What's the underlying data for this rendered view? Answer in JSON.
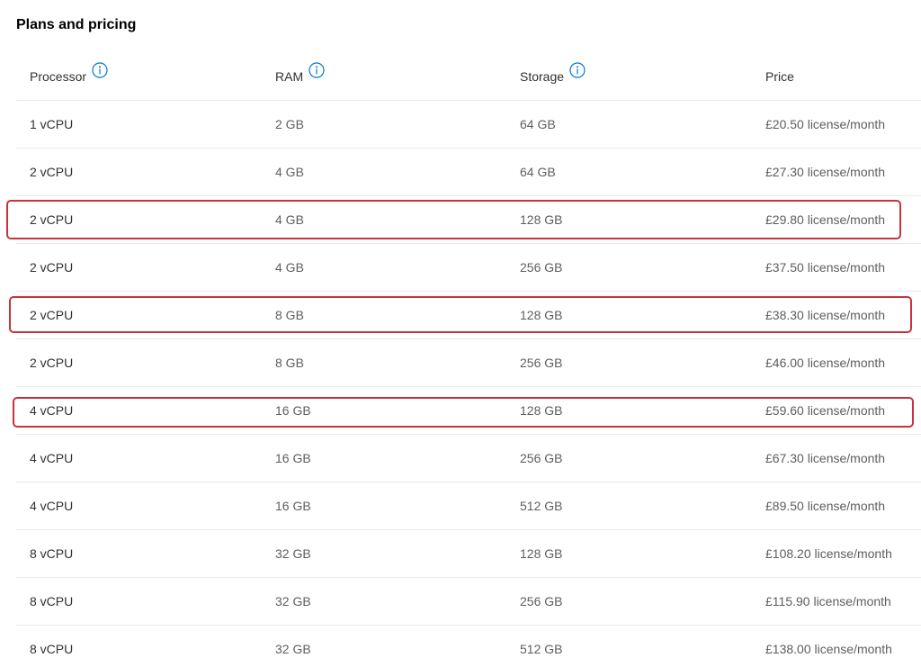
{
  "title": "Plans and pricing",
  "columns": {
    "processor": "Processor",
    "ram": "RAM",
    "storage": "Storage",
    "price": "Price"
  },
  "icons": {
    "info": "info-circle-icon"
  },
  "accent_color": "#c8323c",
  "rows": [
    {
      "processor": "1 vCPU",
      "ram": "2 GB",
      "storage": "64 GB",
      "price": "£20.50 license/month"
    },
    {
      "processor": "2 vCPU",
      "ram": "4 GB",
      "storage": "64 GB",
      "price": "£27.30 license/month"
    },
    {
      "processor": "2 vCPU",
      "ram": "4 GB",
      "storage": "128 GB",
      "price": "£29.80 license/month"
    },
    {
      "processor": "2 vCPU",
      "ram": "4 GB",
      "storage": "256 GB",
      "price": "£37.50 license/month"
    },
    {
      "processor": "2 vCPU",
      "ram": "8 GB",
      "storage": "128 GB",
      "price": "£38.30 license/month"
    },
    {
      "processor": "2 vCPU",
      "ram": "8 GB",
      "storage": "256 GB",
      "price": "£46.00 license/month"
    },
    {
      "processor": "4 vCPU",
      "ram": "16 GB",
      "storage": "128 GB",
      "price": "£59.60 license/month"
    },
    {
      "processor": "4 vCPU",
      "ram": "16 GB",
      "storage": "256 GB",
      "price": "£67.30 license/month"
    },
    {
      "processor": "4 vCPU",
      "ram": "16 GB",
      "storage": "512 GB",
      "price": "£89.50 license/month"
    },
    {
      "processor": "8 vCPU",
      "ram": "32 GB",
      "storage": "128 GB",
      "price": "£108.20 license/month"
    },
    {
      "processor": "8 vCPU",
      "ram": "32 GB",
      "storage": "256 GB",
      "price": "£115.90 license/month"
    },
    {
      "processor": "8 vCPU",
      "ram": "32 GB",
      "storage": "512 GB",
      "price": "£138.00 license/month"
    }
  ]
}
